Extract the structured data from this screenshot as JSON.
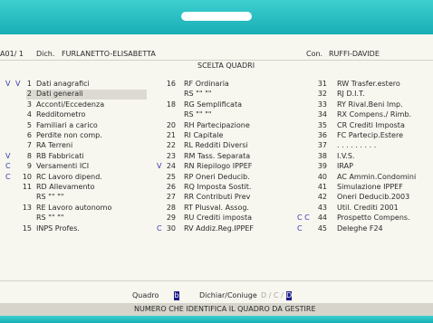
{
  "header": {
    "code": "A01/ 1",
    "dich_label": "Dich.",
    "dichiarante": "FURLANETTO-ELISABETTA",
    "con_label": "Con.",
    "coniuge": "RUFFI-DAVIDE",
    "title": "SCELTA QUADRI"
  },
  "col1": [
    {
      "m1": "V",
      "m2": "V",
      "n": "1",
      "label": "Dati anagrafici"
    },
    {
      "m1": "",
      "m2": "",
      "n": "2",
      "label": "Dati generali"
    },
    {
      "m1": "",
      "m2": "",
      "n": "3",
      "label": "Acconti/Eccedenza"
    },
    {
      "m1": "",
      "m2": "",
      "n": "4",
      "label": "Redditometro"
    },
    {
      "m1": "",
      "m2": "",
      "n": "5",
      "label": "Familiari a carico"
    },
    {
      "m1": "",
      "m2": "",
      "n": "6",
      "label": "Perdite non comp."
    },
    {
      "m1": "",
      "m2": "",
      "n": "7",
      "label": "RA Terreni"
    },
    {
      "m1": "V",
      "m2": "",
      "n": "8",
      "label": "RB Fabbricati"
    },
    {
      "m1": "C",
      "m2": "",
      "n": "9",
      "label": "Versamenti ICI"
    },
    {
      "m1": "C",
      "m2": "",
      "n": "10",
      "label": "RC Lavoro dipend."
    },
    {
      "m1": "",
      "m2": "",
      "n": "11",
      "label": "RD Allevamento"
    },
    {
      "m1": "",
      "m2": "",
      "n": "",
      "label": "RS \"\" \"\""
    },
    {
      "m1": "",
      "m2": "",
      "n": "13",
      "label": "RE Lavoro autonomo"
    },
    {
      "m1": "",
      "m2": "",
      "n": "",
      "label": "RS \"\" \"\""
    },
    {
      "m1": "",
      "m2": "",
      "n": "15",
      "label": "INPS Profes."
    }
  ],
  "col2": [
    {
      "m": "",
      "n": "16",
      "label": "RF Ordinaria"
    },
    {
      "m": "",
      "n": "",
      "label": "RS \"\" \"\""
    },
    {
      "m": "",
      "n": "18",
      "label": "RG Semplificata"
    },
    {
      "m": "",
      "n": "",
      "label": "RS \"\" \"\""
    },
    {
      "m": "",
      "n": "20",
      "label": "RH Partecipazione"
    },
    {
      "m": "",
      "n": "21",
      "label": "RI Capitale"
    },
    {
      "m": "",
      "n": "22",
      "label": "RL Redditi Diversi"
    },
    {
      "m": "",
      "n": "23",
      "label": "RM Tass. Separata"
    },
    {
      "m": "V",
      "n": "24",
      "label": "RN Riepilogo IPPEF"
    },
    {
      "m": "",
      "n": "25",
      "label": "RP Oneri Deducib."
    },
    {
      "m": "",
      "n": "26",
      "label": "RQ Imposta Sostit."
    },
    {
      "m": "",
      "n": "27",
      "label": "RR Contributi Prev"
    },
    {
      "m": "",
      "n": "28",
      "label": "RT Plusval. Assog."
    },
    {
      "m": "",
      "n": "29",
      "label": "RU Crediti imposta"
    },
    {
      "m": "C",
      "n": "30",
      "label": "RV Addiz.Reg.IPPEF"
    }
  ],
  "col3": [
    {
      "m": "",
      "n": "31",
      "label": "RW Trasfer.estero"
    },
    {
      "m": "",
      "n": "32",
      "label": "RJ D.I.T."
    },
    {
      "m": "",
      "n": "33",
      "label": "RY Rival.Beni Imp."
    },
    {
      "m": "",
      "n": "34",
      "label": "RX Compens./ Rimb."
    },
    {
      "m": "",
      "n": "35",
      "label": "CR Crediti Imposta"
    },
    {
      "m": "",
      "n": "36",
      "label": "FC Partecip.Estere"
    },
    {
      "m": "",
      "n": "37",
      "label": ". . . . . . . . ."
    },
    {
      "m": "",
      "n": "38",
      "label": "I.V.S."
    },
    {
      "m": "",
      "n": "39",
      "label": "IRAP"
    },
    {
      "m": "",
      "n": "40",
      "label": "AC Ammin.Condomini"
    },
    {
      "m": "",
      "n": "41",
      "label": "Simulazione IPPEF"
    },
    {
      "m": "",
      "n": "42",
      "label": "Oneri Deducib.2003"
    },
    {
      "m": "",
      "n": "43",
      "label": "Util. Crediti 2001"
    },
    {
      "m": "C C",
      "n": "44",
      "label": "Prospetto Compens."
    },
    {
      "m": "C",
      "n": "45",
      "label": "Deleghe F24"
    }
  ],
  "footer": {
    "quadro_label": "Quadro",
    "quadro_value": "b",
    "dichiar_label": "Dichiar/Coniuge",
    "dc_ghost": "D / C /",
    "dc_value": "D",
    "status": "NUMERO CHE IDENTIFICA IL QUADRO DA GESTIRE"
  },
  "colors": {
    "accent": "#17aeb4",
    "cursor": "#1c1c8a",
    "marker": "#3a3ab0"
  }
}
